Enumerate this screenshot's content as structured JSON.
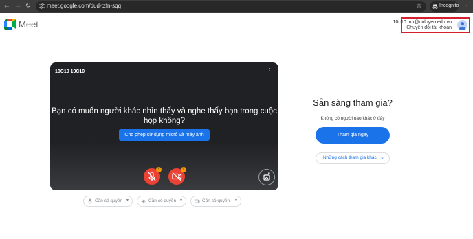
{
  "browser": {
    "url": "meet.google.com/dud-tzfn-sqq",
    "incognito_label": "Incognito"
  },
  "header": {
    "brand": "Meet",
    "account_email": "10c10.tnh@onluyen.edu.vn",
    "switch_account": "Chuyển đổi tài khoản"
  },
  "preview": {
    "participant_name": "10C10 10C10",
    "question": "Bạn có muốn người khác nhìn thấy và nghe thấy bạn trong cuộc họp không?",
    "allow_button": "Cho phép sử dụng micrô và máy ảnh",
    "warning_badge": "!"
  },
  "devices": {
    "microphone": "Cần có quyền",
    "speaker": "Cần có quyền",
    "camera": "Cần có quyền"
  },
  "join_panel": {
    "title": "Sẵn sàng tham gia?",
    "subtitle": "Không có người nào khác ở đây",
    "join_button": "Tham gia ngay",
    "other_ways": "Những cách tham gia khác"
  },
  "colors": {
    "accent": "#1a73e8",
    "danger": "#ea4335",
    "highlight_box": "#d4202f"
  }
}
